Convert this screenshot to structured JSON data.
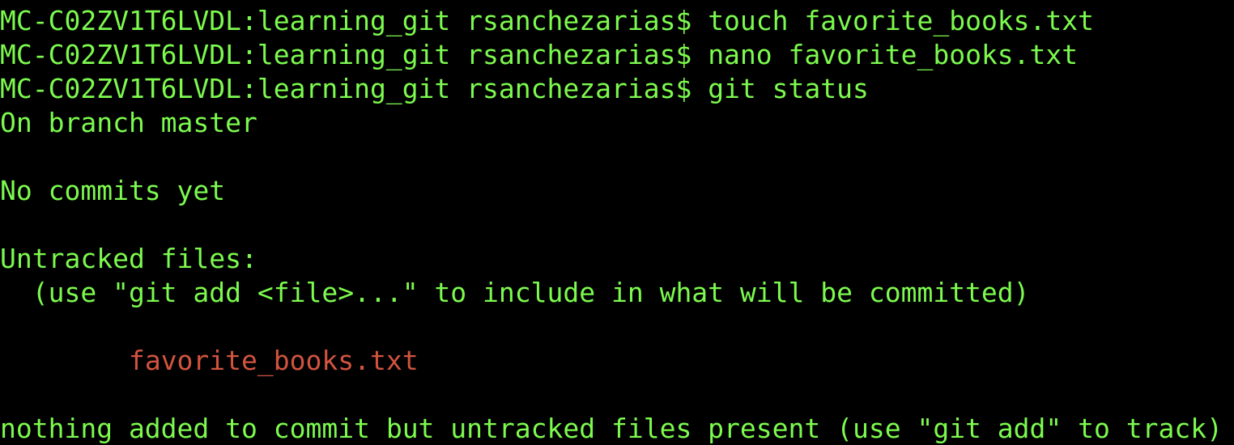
{
  "colors": {
    "background": "#000000",
    "text": "#7CFA4E",
    "untracked": "#D2543F"
  },
  "terminal": {
    "prompt": "MC-C02ZV1T6LVDL:learning_git rsanchezarias$ ",
    "commands": {
      "touch": "touch favorite_books.txt",
      "nano": "nano favorite_books.txt",
      "status": "git status"
    },
    "output": {
      "branch": "On branch master",
      "no_commits": "No commits yet",
      "untracked_header": "Untracked files:",
      "untracked_hint": "  (use \"git add <file>...\" to include in what will be committed)",
      "untracked_file_indent": "        ",
      "untracked_file": "favorite_books.txt",
      "summary": "nothing added to commit but untracked files present (use \"git add\" to track)"
    }
  }
}
